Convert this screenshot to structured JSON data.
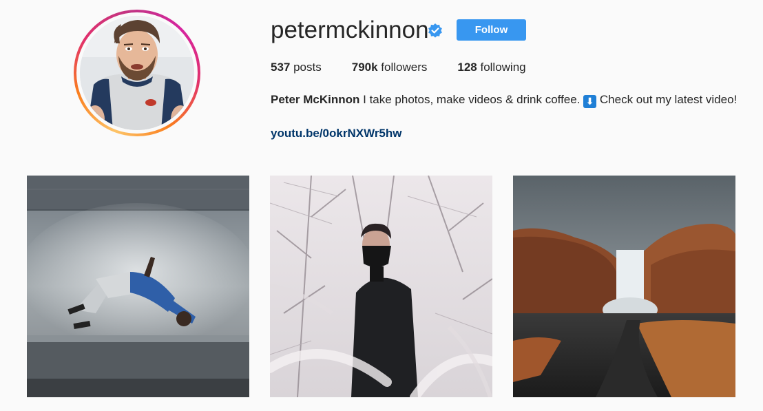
{
  "profile": {
    "username": "petermckinnon",
    "verified_icon": "verified-badge-icon",
    "follow_label": "Follow",
    "avatar_icon": "profile-avatar"
  },
  "stats": {
    "posts_count": "537",
    "posts_label": " posts",
    "followers_count": "790k",
    "followers_label": " followers",
    "following_count": "128",
    "following_label": " following"
  },
  "bio": {
    "name": "Peter McKinnon",
    "text_before_emoji": " I take photos, make videos & drink coffee. ",
    "emoji": "⬇",
    "text_after_emoji": " Check out my latest video!",
    "link": "youtu.be/0okrNXWr5hw"
  },
  "posts": [
    {
      "subject": "post-backflip-photo"
    },
    {
      "subject": "post-snow-forest-portrait-photo"
    },
    {
      "subject": "post-waterfall-landscape-photo"
    }
  ],
  "colors": {
    "accent": "#3897f0",
    "link": "#003569",
    "background": "#fafafa",
    "text": "#262626"
  }
}
